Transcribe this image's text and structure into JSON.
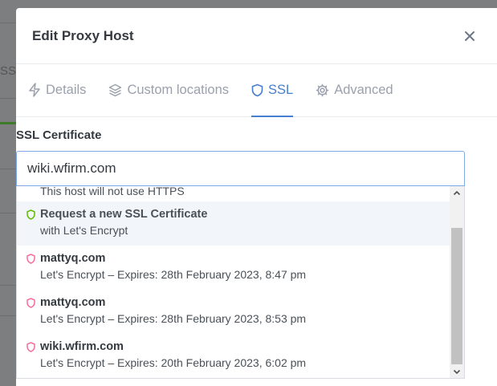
{
  "background": {
    "partial_tab_label": "SSI"
  },
  "modal": {
    "title": "Edit Proxy Host",
    "close_label": "×"
  },
  "tabs": [
    {
      "label": "Details",
      "icon": "lightning-icon",
      "active": false
    },
    {
      "label": "Custom locations",
      "icon": "layers-icon",
      "active": false
    },
    {
      "label": "SSL",
      "icon": "shield-icon",
      "active": true
    },
    {
      "label": "Advanced",
      "icon": "gear-icon",
      "active": false
    }
  ],
  "ssl": {
    "label": "SSL Certificate",
    "value": "wiki.wfirm.com",
    "options": [
      {
        "title": "",
        "subtitle": "This host will not use HTTPS"
      },
      {
        "title": "Request a new SSL Certificate",
        "subtitle": "with Let's Encrypt",
        "icon_color": "#5eba00"
      },
      {
        "title": "mattyq.com",
        "subtitle": "Let's Encrypt – Expires: 28th February 2023, 8:47 pm",
        "icon_color": "#f66d9b"
      },
      {
        "title": "mattyq.com",
        "subtitle": "Let's Encrypt – Expires: 28th February 2023, 8:53 pm",
        "icon_color": "#f66d9b"
      },
      {
        "title": "wiki.wfirm.com",
        "subtitle": "Let's Encrypt – Expires: 20th February 2023, 6:02 pm",
        "icon_color": "#f66d9b"
      }
    ]
  },
  "colors": {
    "accent": "#467fcf",
    "muted": "#9aa0ac"
  }
}
